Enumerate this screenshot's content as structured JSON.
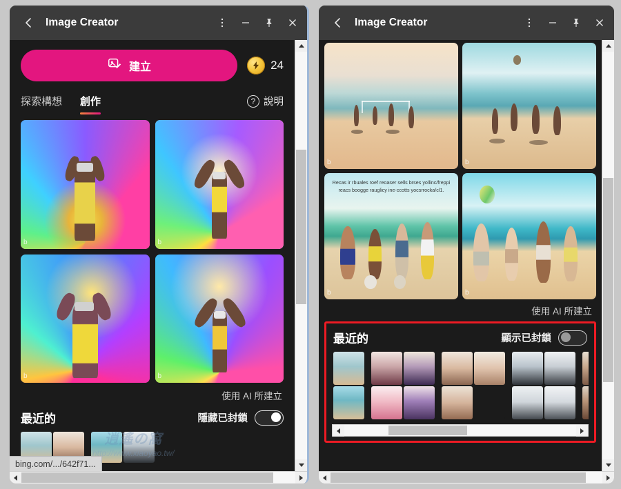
{
  "window_left": {
    "titlebar": {
      "back_icon": "chevron-left-icon",
      "title": "Image Creator",
      "more_icon": "kebab-menu-icon",
      "minimize_icon": "minimize-icon",
      "pin_icon": "pin-icon",
      "close_icon": "close-icon"
    },
    "create_button": {
      "label": "建立",
      "icon": "image-edit-icon"
    },
    "credits": {
      "value": "24",
      "icon": "lightning-coin-icon"
    },
    "tabs": [
      {
        "label": "探索構想",
        "active": false
      },
      {
        "label": "創作",
        "active": true
      }
    ],
    "help": {
      "label": "說明",
      "icon": "question-circle-icon"
    },
    "ai_note": "使用 AI 所建立",
    "recent": {
      "title": "最近的",
      "toggle_label": "隱藏已封鎖",
      "toggle_state": "on"
    },
    "watermark": {
      "big": "逍遙の窩",
      "url": "http://www.xiaoyao.tw/"
    },
    "statusbar": {
      "url": "bing.com/.../642f71..."
    },
    "gallery": [
      {
        "name": "vr-rainbow-woman-yellow-dress",
        "class": "vr1"
      },
      {
        "name": "vr-rainbow-woman-yellow-shorts",
        "class": "vr2"
      },
      {
        "name": "vr-rainbow-woman-pagoda",
        "class": "vr3"
      },
      {
        "name": "vr-rainbow-woman-arms-up",
        "class": "vr4"
      }
    ]
  },
  "window_right": {
    "titlebar": {
      "back_icon": "chevron-left-icon",
      "title": "Image Creator",
      "more_icon": "kebab-menu-icon",
      "minimize_icon": "minimize-icon",
      "pin_icon": "pin-icon",
      "close_icon": "close-icon"
    },
    "ai_note": "使用 AI 所建立",
    "recent": {
      "title": "最近的",
      "toggle_label": "顯示已封鎖",
      "toggle_state": "off"
    },
    "gallery": [
      {
        "name": "beach-volleyball-net",
        "class": "beach1"
      },
      {
        "name": "beach-jumping-group",
        "class": "beach2"
      },
      {
        "name": "beach-soccer-group-with-text",
        "class": "beach3",
        "overlay_text": "Recas ir rbuales roef reoaser sells brses yollinc/freppireacs boogge rauglicy ine-ccotts yocsrrocka/cl1."
      },
      {
        "name": "beach-volleyball-women",
        "class": "beach4"
      }
    ],
    "thumbnails": [
      {
        "group": "beach-set",
        "items": [
          "p-bch1",
          "p-bch2"
        ]
      },
      {
        "group": "anime-set",
        "items": [
          "p-anime1",
          "p-anime2",
          "p-anime3",
          "p-anime4"
        ]
      },
      {
        "group": "portrait-set",
        "items": [
          "p-port1",
          "p-port2",
          "p-port3",
          "p-empty"
        ]
      },
      {
        "group": "office-set",
        "items": [
          "p-off1",
          "p-off2",
          "p-off3",
          "p-off4"
        ]
      },
      {
        "group": "group-set",
        "items": [
          "p-grp1",
          "p-grp2"
        ]
      }
    ]
  },
  "colors": {
    "accent_pink": "#e3167f",
    "accent_orange": "#f5833f",
    "highlight_red": "#ee1b24",
    "window_chrome": "#3b3b3b",
    "page_bg": "#1b1b1b",
    "focus_border": "#9fb8d8"
  }
}
